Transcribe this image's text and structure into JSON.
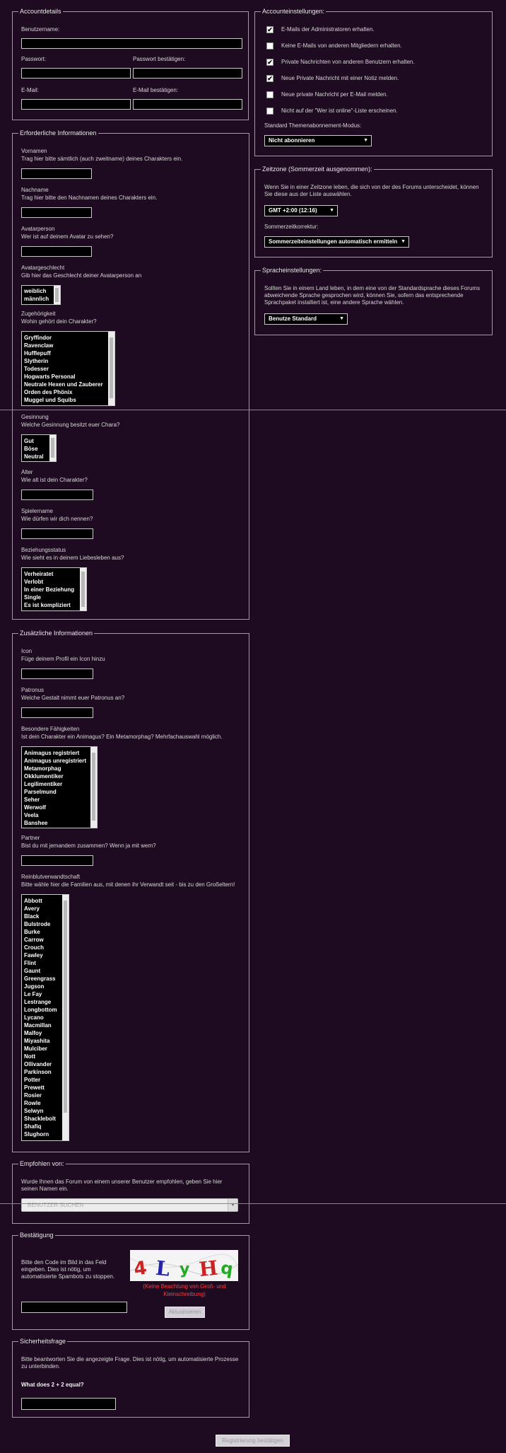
{
  "account": {
    "legend": "Accountdetails",
    "username_label": "Benutzername:",
    "password_label": "Passwort:",
    "password_confirm_label": "Passwort bestätigen:",
    "email_label": "E-Mail:",
    "email_confirm_label": "E-Mail bestätigen:"
  },
  "required": {
    "legend": "Erforderliche Informationen",
    "vorname_label": "Vornamen",
    "vorname_desc": "Trag hier bitte sämtlich (auch zweitname) deines Charakters ein.",
    "nachname_label": "Nachname",
    "nachname_desc": "Trag hier bitte den Nachnamen deines Charakters ein.",
    "avatar_label": "Avatarperson",
    "avatar_desc": "Wer ist auf deinem Avatar zu sehen?",
    "gender_label": "Avatargeschlecht",
    "gender_desc": "Gib hier das Geschlecht deiner Avatarperson an",
    "gender_options": [
      "weiblich",
      "männlich"
    ],
    "house_label": "Zugehörigkeit",
    "house_desc": "Wohin gehört dein Charakter?",
    "house_options": [
      "Gryffindor",
      "Ravenclaw",
      "Hufflepuff",
      "Slytherin",
      "Todesser",
      "Hogwarts Personal",
      "Neutrale Hexen und Zauberer",
      "Orden des Phönix",
      "Muggel und Squibs"
    ],
    "alignment_label": "Gesinnung",
    "alignment_desc": "Welche Gesinnung besitzt euer Chara?",
    "alignment_options": [
      "Gut",
      "Böse",
      "Neutral"
    ],
    "age_label": "Alter",
    "age_desc": "Wie alt ist dein Charakter?",
    "player_label": "Spielername",
    "player_desc": "Wie dürfen wir dich nennen?",
    "relationship_label": "Beziehungsstatus",
    "relationship_desc": "Wie sieht es in deinem Liebesleben aus?",
    "relationship_options": [
      "Verheiratet",
      "Verlobt",
      "In einer Beziehung",
      "Single",
      "Es ist kompliziert"
    ]
  },
  "additional": {
    "legend": "Zusätzliche Informationen",
    "icon_label": "Icon",
    "icon_desc": "Füge deinem Profil ein Icon hinzu",
    "patronus_label": "Patronus",
    "patronus_desc": "Welche Gestalt nimmt euer Patronus an?",
    "abilities_label": "Besondere Fähigkeiten",
    "abilities_desc": "Ist dein Charakter ein Animagus? Ein Metamorphag? Mehrfachauswahl möglich.",
    "abilities_options": [
      "Animagus registriert",
      "Animagus unregistriert",
      "Metamorphag",
      "Okklumentiker",
      "Legilimentiker",
      "Parselmund",
      "Seher",
      "Werwolf",
      "Veela",
      "Banshee"
    ],
    "partner_label": "Partner",
    "partner_desc": "Bist du mit jemandem zusammen? Wenn ja mit wem?",
    "pureblood_label": "Reinblutverwandtschaft",
    "pureblood_desc": "Bitte wähle hier die Familien aus, mit denen ihr Verwandt seit - bis zu den Großeltern!",
    "pureblood_options": [
      "Abbott",
      "Avery",
      "Black",
      "Bulstrode",
      "Burke",
      "Carrow",
      "Crouch",
      "Fawley",
      "Flint",
      "Gaunt",
      "Greengrass",
      "Jugson",
      "Le Fay",
      "Lestrange",
      "Longbottom",
      "Lycano",
      "Macmillan",
      "Malfoy",
      "Miyashita",
      "Mulciber",
      "Nott",
      "Ollivander",
      "Parkinson",
      "Potter",
      "Prewett",
      "Rosier",
      "Rowle",
      "Selwyn",
      "Shacklebolt",
      "Shafiq",
      "Slughorn"
    ]
  },
  "referral": {
    "legend": "Empfohlen von:",
    "desc": "Wurde Ihnen das Forum von einem unserer Benutzer empfohlen, geben Sie hier seinen Namen ein.",
    "placeholder": "BENUTZER SUCHEN"
  },
  "captcha": {
    "legend": "Bestätigung",
    "desc": "Bitte den Code im Bild in das Feld eingeben. Dies ist nötig, um automatisierte Spambots zu stoppen.",
    "note": "(Keine Beachtung von Groß- und Kleinschreibung)",
    "refresh": "Aktualisieren",
    "code": "4LyHq"
  },
  "security": {
    "legend": "Sicherheitsfrage",
    "desc": "Bitte beantworten Sie die angezeigte Frage. Dies ist nötig, um automatisierte Prozesse zu unterbinden.",
    "question": "What does 2 + 2 equal?"
  },
  "settings": {
    "legend": "Accounteinstellungen:",
    "options": [
      "E-Mails der Administratoren erhalten.",
      "Keine E-Mails von anderen Mitgliedern erhalten.",
      "Private Nachrichten von anderen Benutzern erhalten.",
      "Neue Private Nachricht mit einer Notiz melden.",
      "Neue private Nachricht per E-Mail melden.",
      "Nicht auf der \"Wer ist online\"-Liste erscheinen."
    ],
    "checked": [
      true,
      false,
      true,
      true,
      false,
      false
    ],
    "subscription_label": "Standard Themenabonnement-Modus:",
    "subscription_value": "Nicht abonnieren"
  },
  "timezone": {
    "legend": "Zeitzone (Sommerzeit ausgenommen):",
    "desc": "Wenn Sie in einer Zeitzone leben, die sich von der des Forums unterscheidet, können Sie diese aus der Liste auswählen.",
    "value": "GMT +2:00 (12:16)",
    "dst_label": "Sommerzeitkorrektur:",
    "dst_value": "Sommerzeiteinstellungen automatisch ermitteln"
  },
  "language": {
    "legend": "Spracheinstellungen:",
    "desc": "Sollten Sie in einem Land leben, in dem eine von der Standardsprache dieses Forums abweichende Sprache gesprochen wird, können Sie, sofern das entsprechende Sprachpaket installiert ist, eine andere Sprache wählen.",
    "value": "Benutze Standard"
  },
  "submit": "Registrierung bestätigen",
  "colors": {
    "background": "#1f0b21",
    "captcha_note": "#ff3c3c"
  }
}
